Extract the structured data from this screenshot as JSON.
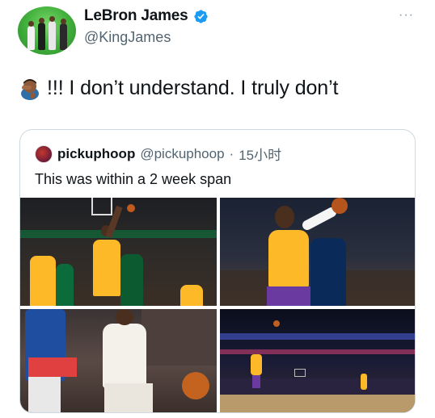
{
  "tweet": {
    "author": {
      "display_name": "LeBron James",
      "handle": "@KingJames",
      "verified": true,
      "avatar_icon": "avatar-photo"
    },
    "more_label": "···",
    "emoji": "man-facepalming-emoji",
    "text": "!!! I don’t understand. I truly don’t",
    "quoted": {
      "author": {
        "display_name": "pickuphoop",
        "handle": "@pickuphoop",
        "separator": "·",
        "time": "15小时",
        "avatar_icon": "pickuphoop-logo"
      },
      "text": "This was within a 2 week span",
      "photos": [
        {
          "label": "photo-lebron-dunk-celtics"
        },
        {
          "label": "photo-lebron-mavericks"
        },
        {
          "label": "photo-westbrook-76ers"
        },
        {
          "label": "photo-lebron-arena"
        }
      ]
    }
  },
  "colors": {
    "verified_blue": "#1d9bf0",
    "secondary_text": "#536471",
    "lakers_gold": "#fdb927",
    "lakers_purple": "#552583"
  }
}
